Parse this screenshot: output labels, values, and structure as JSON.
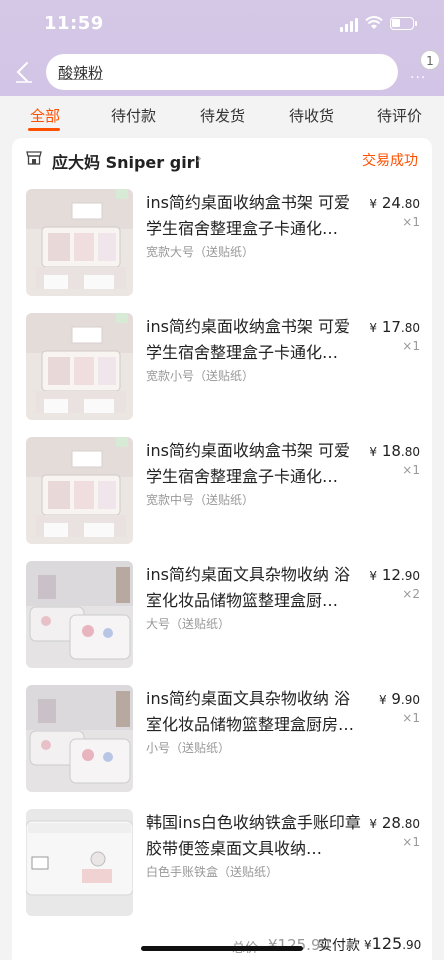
{
  "status_bar": {
    "time": "11:59"
  },
  "header": {
    "search_value": "酸辣粉",
    "more_badge": "1",
    "more_dots": "···"
  },
  "tabs": [
    {
      "label": "全部",
      "active": true
    },
    {
      "label": "待付款"
    },
    {
      "label": "待发货"
    },
    {
      "label": "待收货"
    },
    {
      "label": "待评价"
    }
  ],
  "order": {
    "shop_name": "应大妈 Sniper girl",
    "shop_chevron": "›",
    "status": "交易成功",
    "items": [
      {
        "title": "ins简约桌面收纳盒书架 可爱学生宿舍整理盒子卡通化…",
        "sku": "宽款大号（送贴纸）",
        "currency": "¥",
        "price_int": "24",
        "price_dec": ".80",
        "qty": "×1"
      },
      {
        "title": "ins简约桌面收纳盒书架 可爱学生宿舍整理盒子卡通化…",
        "sku": "宽款小号（送贴纸）",
        "currency": "¥",
        "price_int": "17",
        "price_dec": ".80",
        "qty": "×1"
      },
      {
        "title": "ins简约桌面收纳盒书架 可爱学生宿舍整理盒子卡通化…",
        "sku": "宽款中号（送贴纸）",
        "currency": "¥",
        "price_int": "18",
        "price_dec": ".80",
        "qty": "×1"
      },
      {
        "title": "ins简约桌面文具杂物收纳 浴室化妆品储物篮整理盒厨…",
        "sku": "大号（送贴纸）",
        "currency": "¥",
        "price_int": "12",
        "price_dec": ".90",
        "qty": "×2"
      },
      {
        "title": "ins简约桌面文具杂物收纳 浴室化妆品储物篮整理盒厨房…",
        "sku": "小号（送贴纸）",
        "currency": "¥",
        "price_int": "9",
        "price_dec": ".90",
        "qty": "×1"
      },
      {
        "title": "韩国ins白色收纳铁盒手账印章胶带便签桌面文具收纳…",
        "sku": "白色手账铁盒（送贴纸）",
        "currency": "¥",
        "price_int": "28",
        "price_dec": ".80",
        "qty": "×1"
      }
    ],
    "total_label": "总价",
    "total_value": "¥125.90",
    "paid_label": "实付款",
    "paid_currency": "¥",
    "paid_int": "125",
    "paid_dec": ".90"
  },
  "colors": {
    "accent": "#ff5000",
    "header_bg": "#d3c6e6"
  }
}
